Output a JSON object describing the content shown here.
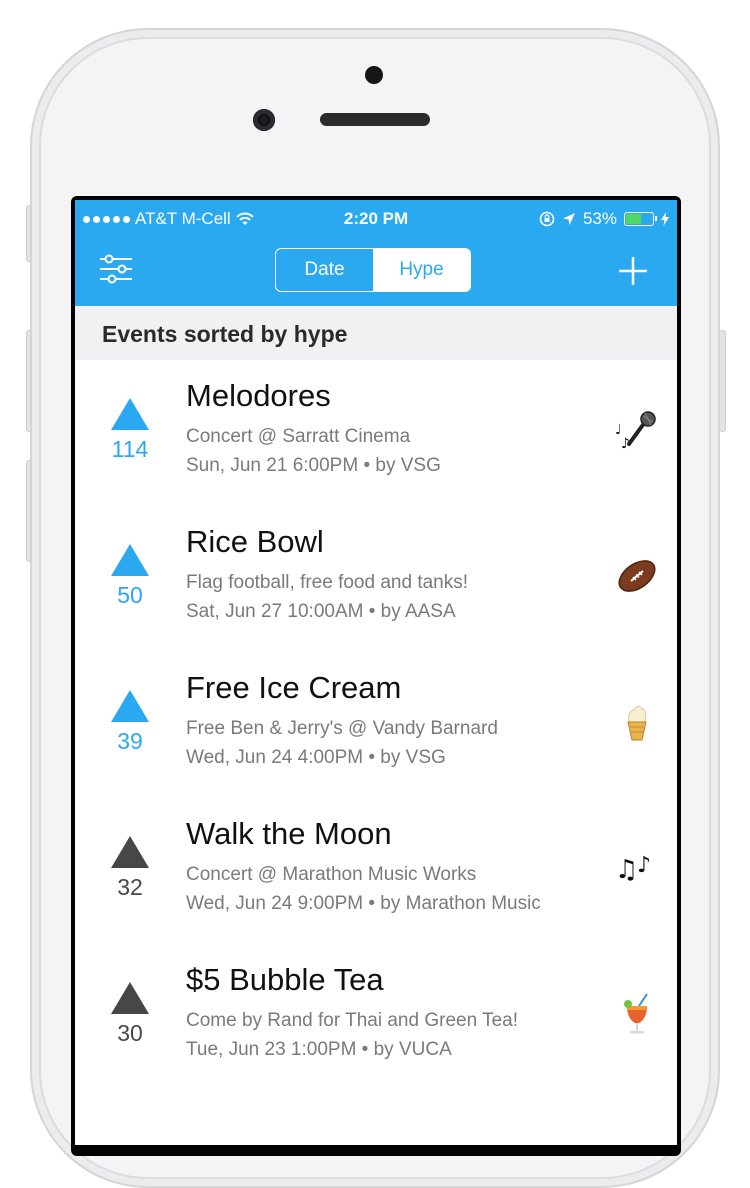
{
  "status_bar": {
    "carrier": "AT&T M-Cell",
    "time": "2:20 PM",
    "battery": "53%"
  },
  "nav": {
    "segments": [
      "Date",
      "Hype"
    ],
    "selected_segment": "Hype",
    "accent_color": "#2aa9f1"
  },
  "section": {
    "title": "Events sorted by hype"
  },
  "events": [
    {
      "votes": "114",
      "title": "Melodores",
      "description": "Concert @ Sarratt Cinema",
      "meta": "Sun, Jun 21 6:00PM • by VSG",
      "icon": "microphone-music-icon",
      "upvoted": true
    },
    {
      "votes": "50",
      "title": "Rice Bowl",
      "description": "Flag football, free food and tanks!",
      "meta": "Sat, Jun 27 10:00AM • by AASA",
      "icon": "football-icon",
      "upvoted": true
    },
    {
      "votes": "39",
      "title": "Free Ice Cream",
      "description": "Free Ben & Jerry's @ Vandy Barnard",
      "meta": "Wed, Jun 24 4:00PM • by VSG",
      "icon": "ice-cream-icon",
      "upvoted": true
    },
    {
      "votes": "32",
      "title": "Walk the Moon",
      "description": "Concert @ Marathon Music Works",
      "meta": "Wed, Jun 24 9:00PM • by Marathon Music",
      "icon": "music-notes-icon",
      "upvoted": false
    },
    {
      "votes": "30",
      "title": "$5 Bubble Tea",
      "description": "Come by Rand for Thai and Green Tea!",
      "meta": "Tue, Jun 23 1:00PM • by VUCA",
      "icon": "tropical-drink-icon",
      "upvoted": false
    }
  ]
}
